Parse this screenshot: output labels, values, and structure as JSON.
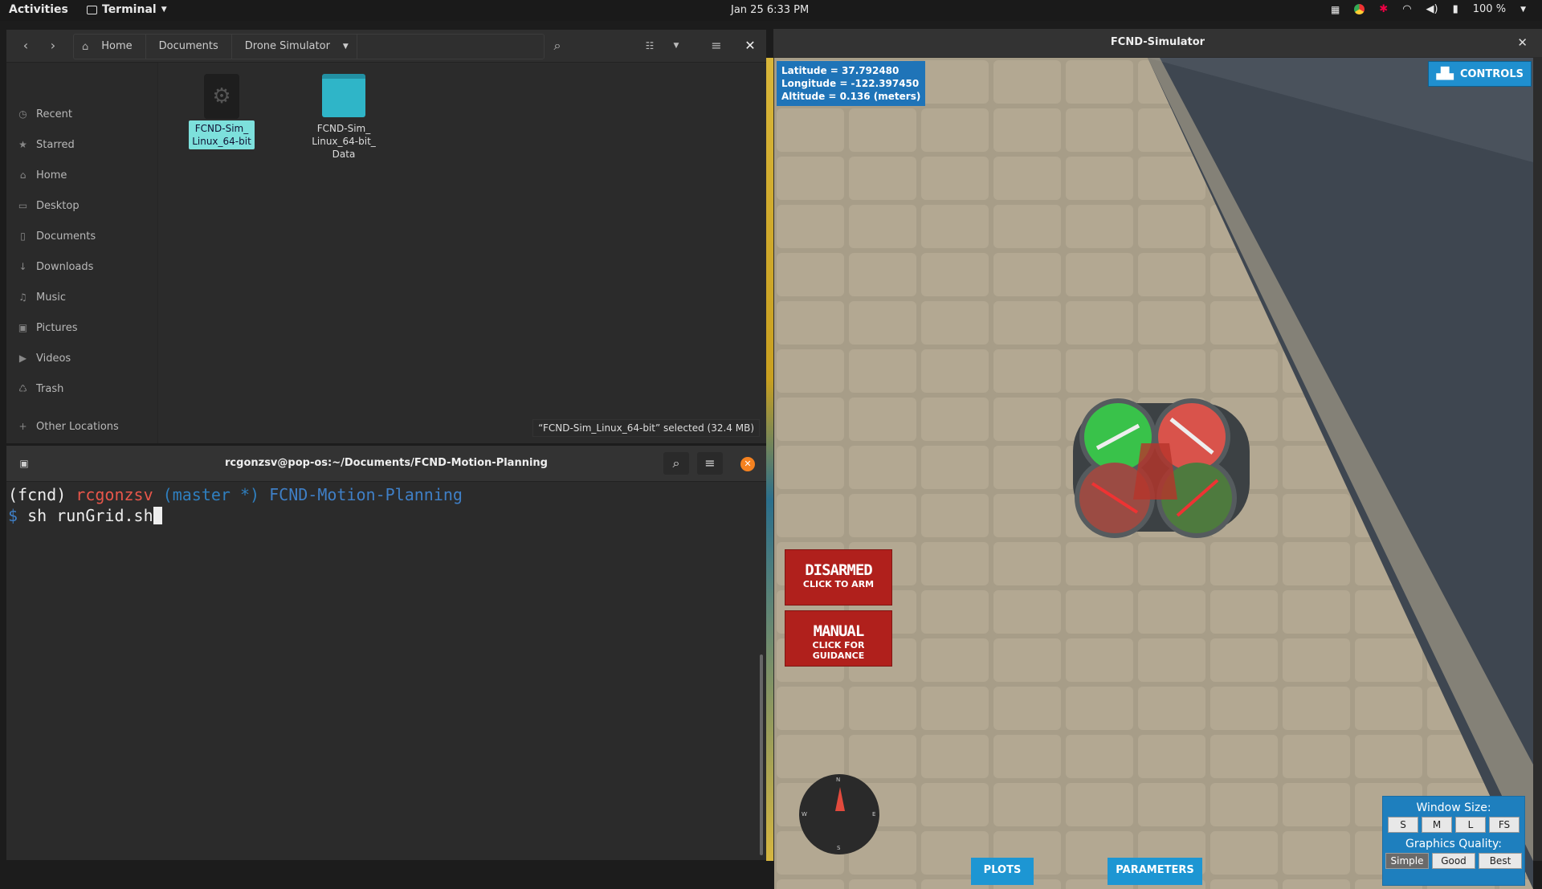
{
  "topbar": {
    "activities": "Activities",
    "app_name": "Terminal",
    "datetime": "Jan 25   6:33 PM",
    "battery": "100 %"
  },
  "files": {
    "breadcrumbs": [
      "Home",
      "Documents",
      "Drone Simulator"
    ],
    "sidebar": [
      {
        "label": "Recent",
        "icon": "clock-icon"
      },
      {
        "label": "Starred",
        "icon": "star-icon"
      },
      {
        "label": "Home",
        "icon": "home-icon"
      },
      {
        "label": "Desktop",
        "icon": "desktop-icon"
      },
      {
        "label": "Documents",
        "icon": "document-icon"
      },
      {
        "label": "Downloads",
        "icon": "download-icon"
      },
      {
        "label": "Music",
        "icon": "music-icon"
      },
      {
        "label": "Pictures",
        "icon": "picture-icon"
      },
      {
        "label": "Videos",
        "icon": "video-icon"
      },
      {
        "label": "Trash",
        "icon": "trash-icon"
      },
      {
        "label": "Other Locations",
        "icon": "plus-icon"
      }
    ],
    "items": [
      {
        "name": "FCND-Sim_\nLinux_64-bit",
        "type": "executable",
        "selected": true
      },
      {
        "name": "FCND-Sim_\nLinux_64-bit_\nData",
        "type": "folder",
        "selected": false
      }
    ],
    "status": "“FCND-Sim_Linux_64-bit” selected  (32.4 MB)"
  },
  "terminal": {
    "title": "rcgonzsv@pop-os:~/Documents/FCND-Motion-Planning",
    "env": "(fcnd)",
    "user": "rcgonzsv",
    "branch": "(master *)",
    "dir": "FCND-Motion-Planning",
    "prompt": "$",
    "command": "sh runGrid.sh"
  },
  "sim": {
    "title": "FCND-Simulator",
    "latitude": "Latitude = 37.792480",
    "longitude": "Longitude = -122.397450",
    "altitude": "Altitude = 0.136 (meters)",
    "controls": "CONTROLS",
    "armed_status": "DISARMED",
    "arm_hint": "CLICK TO ARM",
    "mode": "MANUAL",
    "mode_hint": "CLICK FOR GUIDANCE",
    "plots": "PLOTS",
    "parameters": "PARAMETERS",
    "window_size_label": "Window Size:",
    "window_sizes": [
      "S",
      "M",
      "L",
      "FS"
    ],
    "graphics_label": "Graphics Quality:",
    "graphics": [
      "Simple",
      "Good",
      "Best"
    ],
    "compass": {
      "n": "N",
      "e": "E",
      "s": "S",
      "w": "W"
    }
  },
  "colors": {
    "accent": "#1d96d3",
    "danger": "#b0201c",
    "selection": "#7de0dc"
  }
}
